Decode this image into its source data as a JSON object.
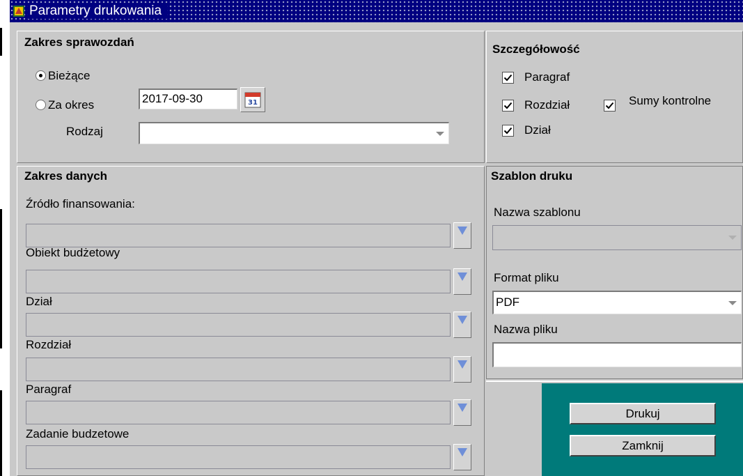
{
  "window": {
    "title": "Parametry drukowania"
  },
  "zakres_sprawozdan": {
    "header": "Zakres sprawozdań",
    "radio_biezace": "Bieżące",
    "radio_za_okres": "Za okres",
    "selected": "Bieżące",
    "date_value": "2017-09-30",
    "calendar_day": "31",
    "rodzaj_label": "Rodzaj",
    "rodzaj_value": ""
  },
  "szczegolowosc": {
    "header": "Szczegółowość",
    "paragraf": "Paragraf",
    "paragraf_checked": true,
    "rozdzial": "Rozdział",
    "rozdzial_checked": true,
    "sumy": "Sumy kontrolne",
    "sumy_checked": true,
    "dzial": "Dział",
    "dzial_checked": true
  },
  "zakres_danych": {
    "header": "Zakres danych",
    "fields": [
      {
        "label": "Źródło finansowania:",
        "value": ""
      },
      {
        "label": "Obiekt budżetowy",
        "value": ""
      },
      {
        "label": "Dział",
        "value": ""
      },
      {
        "label": "Rozdział",
        "value": ""
      },
      {
        "label": "Paragraf",
        "value": ""
      },
      {
        "label": "Zadanie budzetowe",
        "value": ""
      }
    ]
  },
  "szablon_druku": {
    "header": "Szablon druku",
    "nazwa_szablonu_label": "Nazwa szablonu",
    "nazwa_szablonu_value": "",
    "format_label": "Format pliku",
    "format_value": "PDF",
    "nazwa_pliku_label": "Nazwa pliku",
    "nazwa_pliku_value": ""
  },
  "buttons": {
    "drukuj": "Drukuj",
    "zamknij": "Zamknij"
  },
  "colors": {
    "titlebar": "#000080",
    "background": "#c9c9c9",
    "button_area": "#007a7a"
  }
}
